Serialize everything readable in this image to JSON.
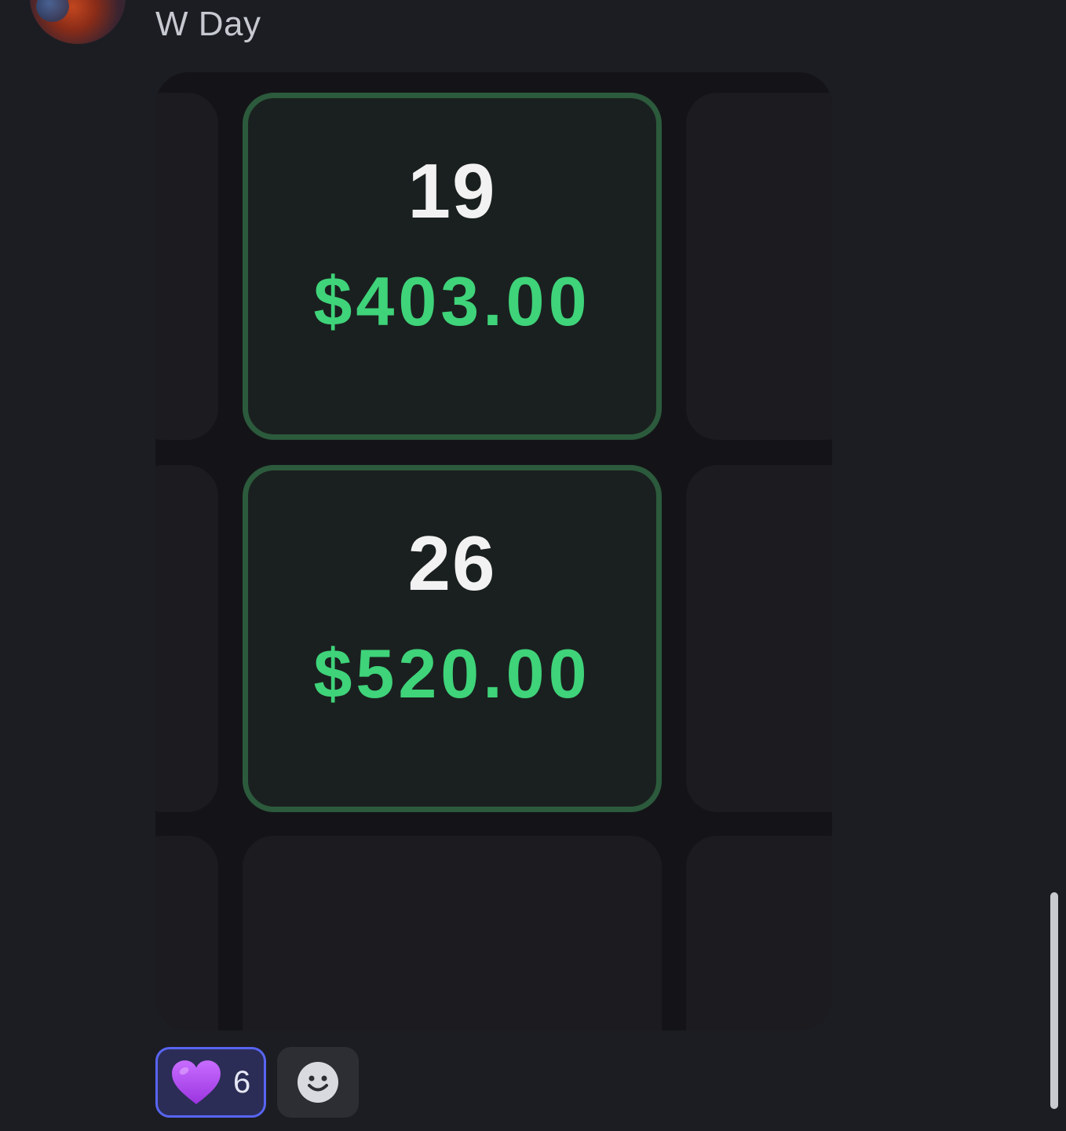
{
  "message": {
    "author": "W Day"
  },
  "calendar": {
    "cells": [
      {
        "day": "19",
        "amount": "$403.00"
      },
      {
        "day": "26",
        "amount": "$520.00"
      }
    ]
  },
  "reactions": [
    {
      "emoji": "purple-heart",
      "count": "6",
      "selected": true
    },
    {
      "emoji": "add-reaction",
      "count": null,
      "selected": false
    }
  ],
  "colors": {
    "background": "#1c1d22",
    "amount_green": "#3fd37a",
    "active_border": "#2c5a3c",
    "reaction_selected_border": "#5865f2",
    "heart": "#b44ef0"
  }
}
